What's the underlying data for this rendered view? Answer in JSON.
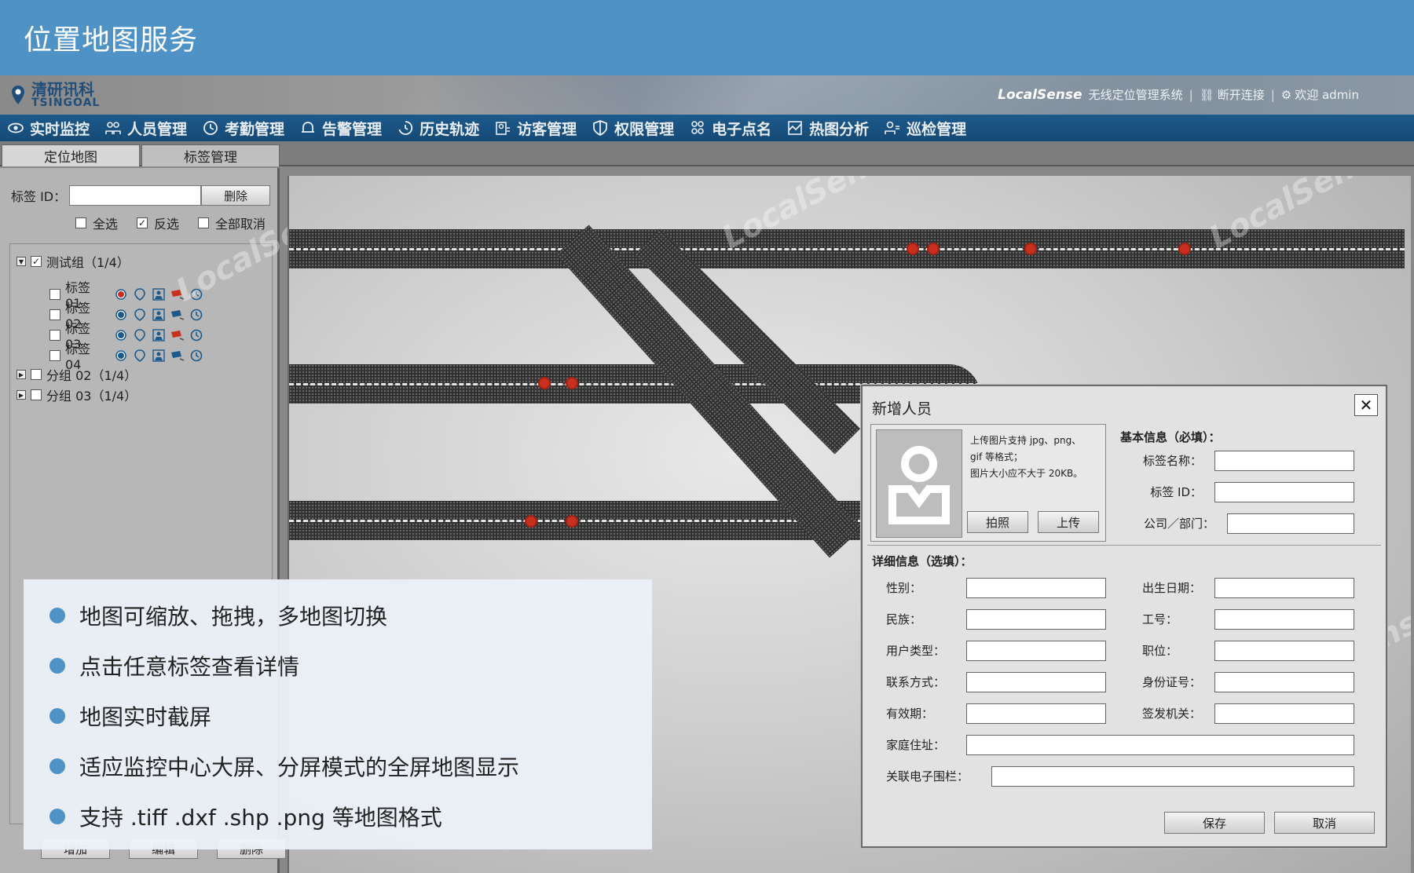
{
  "slide": {
    "title": "位置地图服务"
  },
  "app": {
    "logo": {
      "cn": "清研讯科",
      "en": "TSINGOAL"
    },
    "system": {
      "brand": "LocalSense",
      "name": "无线定位管理系统",
      "disconnect": "断开连接",
      "welcome": "欢迎 admin"
    },
    "nav": [
      "实时监控",
      "人员管理",
      "考勤管理",
      "告警管理",
      "历史轨迹",
      "访客管理",
      "权限管理",
      "电子点名",
      "热图分析",
      "巡检管理"
    ],
    "subtabs": [
      "定位地图",
      "标签管理"
    ]
  },
  "left_panel": {
    "tag_id_label": "标签 ID：",
    "delete_button": "删除",
    "select_all": "全选",
    "invert": "反选",
    "deselect_all": "全部取消",
    "groups": [
      {
        "name": "测试组（1/4）",
        "expanded": true,
        "checked": true
      },
      {
        "name": "分组 02（1/4）",
        "expanded": false,
        "checked": false
      },
      {
        "name": "分组 03（1/4）",
        "expanded": false,
        "checked": false
      }
    ],
    "tags": [
      "标签 01",
      "标签 02",
      "标签 03",
      "标签 04"
    ],
    "bottom_buttons": [
      "增加",
      "编辑",
      "删除"
    ]
  },
  "map": {
    "watermark": "LocalSense"
  },
  "dialog": {
    "title": "新增人员",
    "close": "✕",
    "photo_hint": [
      "上传图片支持 jpg、png、",
      "gif 等格式；",
      "图片大小应不大于 20KB。"
    ],
    "photo_button": "拍照",
    "upload_button": "上传",
    "basic_section": "基本信息（必填）：",
    "basic_fields": [
      "标签名称：",
      "标签 ID：",
      "公司／部门："
    ],
    "detail_section": "详细信息（选填）：",
    "detail_left": [
      "性别：",
      "民族：",
      "用户类型：",
      "联系方式：",
      "有效期："
    ],
    "detail_right": [
      "出生日期：",
      "工号：",
      "职位：",
      "身份证号：",
      "签发机关："
    ],
    "address": "家庭住址：",
    "fence": "关联电子围栏：",
    "save": "保存",
    "cancel": "取消"
  },
  "bullets": [
    "地图可缩放、拖拽，多地图切换",
    "点击任意标签查看详情",
    "地图实时截屏",
    "适应监控中心大屏、分屏模式的全屏地图显示",
    "支持 .tiff .dxf .shp .png 等地图格式"
  ]
}
